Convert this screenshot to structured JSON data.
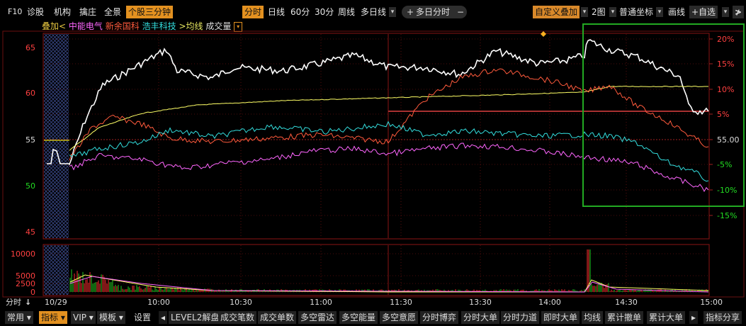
{
  "toolbar": {
    "f10": "F10",
    "diagnose": "诊股",
    "institution": "机构",
    "pick": "擒庄",
    "panorama": "全景",
    "stock_three_min": "个股三分钟",
    "intraday": "分时",
    "daily": "日线",
    "min60": "60分",
    "min30": "30分",
    "weekly": "周线",
    "multi_day": "多日线",
    "plus": "+",
    "multi_day_intraday": "多日分时",
    "minus": "−",
    "custom_overlay": "自定义叠加",
    "two_charts": "2图",
    "coord": "普通坐标",
    "draw_line": "画线",
    "add_watch": "+自选",
    "collapse": "≯"
  },
  "overlay_bar": {
    "overlay": "叠加",
    "lt": "<",
    "s1": "中能电气",
    "s2": "新余国科",
    "s3": "浩丰科技",
    "gt": ">",
    "avg": "均线",
    "vol": "成交量"
  },
  "price_axis": {
    "left": [
      "65",
      "60",
      "55",
      "50",
      "45"
    ],
    "right": [
      "20%",
      "15%",
      "10%",
      "5%",
      "55.00",
      "-5%",
      "-10%",
      "-15%"
    ]
  },
  "volume_axis": [
    "10000",
    "5000",
    "2500",
    "0"
  ],
  "time_axis": {
    "label": "分时",
    "ticks": [
      "10/29",
      "10:00",
      "10:30",
      "11:00",
      "11:30",
      "13:30",
      "14:00",
      "14:30",
      "15:00"
    ]
  },
  "bottom_bar": {
    "common": "常用",
    "indicator": "指标",
    "vip": "VIP",
    "template": "模板",
    "settings": "设置",
    "tabs": [
      "LEVEL2解盘",
      "成交笔数",
      "成交单数",
      "多空雷达",
      "多空能量",
      "多空意愿",
      "分时博弈",
      "分时大单",
      "分时力道",
      "即时大单",
      "均线",
      "累计撤单",
      "累计大单"
    ],
    "share": "指标分享"
  },
  "colors": {
    "main": "#ffffff",
    "s1": "#ff66ff",
    "s2": "#ff5a3c",
    "s3": "#33dddd",
    "avg": "#ffff66",
    "grid": "#7a1010",
    "highlight": "#22aa22"
  }
}
